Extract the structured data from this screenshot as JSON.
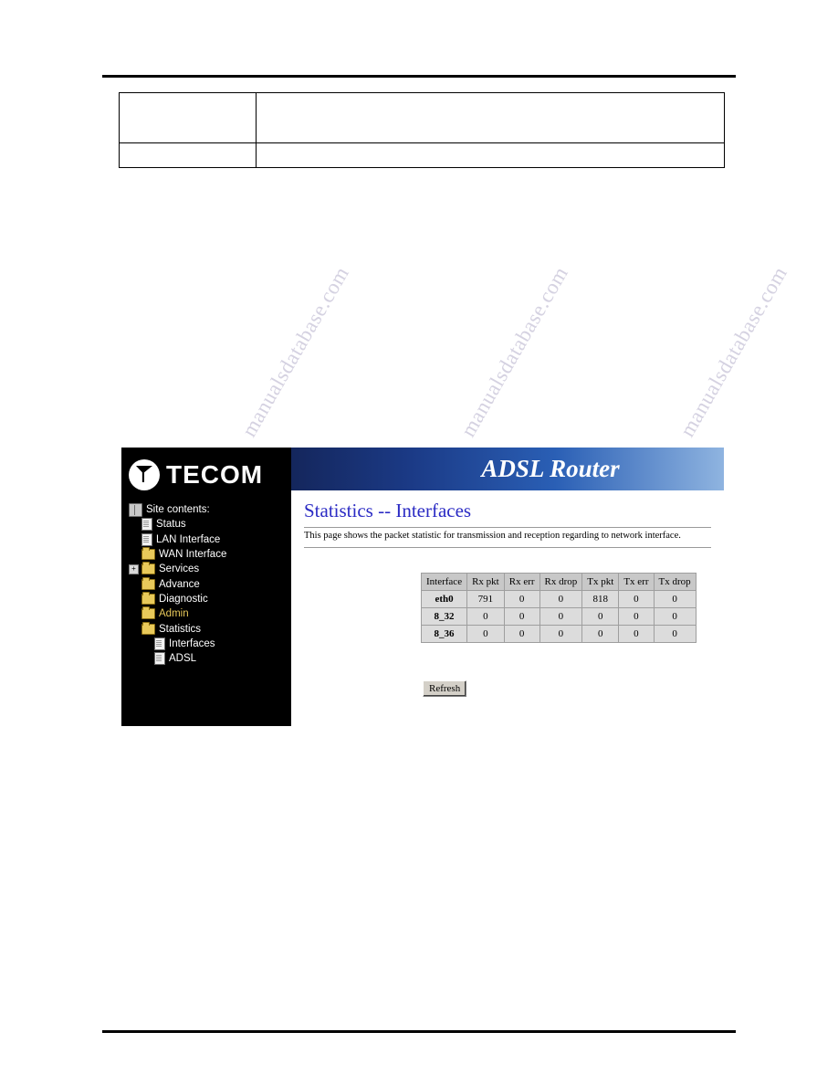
{
  "document": {
    "top_table": {
      "rows": [
        {
          "cells": [
            "",
            ""
          ]
        },
        {
          "cells": [
            "",
            ""
          ]
        }
      ]
    },
    "watermarks": [
      "manualsdatabase.com",
      "manualsdatabase.com",
      "manualsdatabase.com"
    ]
  },
  "router_ui": {
    "brand": {
      "logo_text": "TECOM",
      "logo_icon": "tecom-arrow-logo"
    },
    "banner_title": "ADSL Router",
    "sidebar": {
      "header": "Site contents:",
      "items": [
        {
          "label": "Status",
          "icon": "page-icon",
          "indent": 1,
          "expandable": false,
          "color": "white"
        },
        {
          "label": "LAN Interface",
          "icon": "page-icon",
          "indent": 1,
          "expandable": false,
          "color": "white"
        },
        {
          "label": "WAN Interface",
          "icon": "folder-icon",
          "indent": 1,
          "expandable": false,
          "color": "white"
        },
        {
          "label": "Services",
          "icon": "folder-icon",
          "indent": 1,
          "expandable": true,
          "color": "white"
        },
        {
          "label": "Advance",
          "icon": "folder-icon",
          "indent": 1,
          "expandable": false,
          "color": "white"
        },
        {
          "label": "Diagnostic",
          "icon": "folder-icon",
          "indent": 1,
          "expandable": false,
          "color": "white"
        },
        {
          "label": "Admin",
          "icon": "folder-icon",
          "indent": 1,
          "expandable": false,
          "color": "yellow"
        },
        {
          "label": "Statistics",
          "icon": "folder-icon",
          "indent": 1,
          "expandable": false,
          "color": "white"
        },
        {
          "label": "Interfaces",
          "icon": "page-icon",
          "indent": 2,
          "expandable": false,
          "color": "white"
        },
        {
          "label": "ADSL",
          "icon": "page-icon",
          "indent": 2,
          "expandable": false,
          "color": "white"
        }
      ]
    },
    "main": {
      "title": "Statistics -- Interfaces",
      "description": "This page shows the packet statistic for transmission and reception regarding to network interface.",
      "table": {
        "headers": [
          "Interface",
          "Rx pkt",
          "Rx err",
          "Rx drop",
          "Tx pkt",
          "Tx err",
          "Tx drop"
        ],
        "rows": [
          [
            "eth0",
            "791",
            "0",
            "0",
            "818",
            "0",
            "0"
          ],
          [
            "8_32",
            "0",
            "0",
            "0",
            "0",
            "0",
            "0"
          ],
          [
            "8_36",
            "0",
            "0",
            "0",
            "0",
            "0",
            "0"
          ]
        ]
      },
      "refresh_label": "Refresh"
    }
  }
}
